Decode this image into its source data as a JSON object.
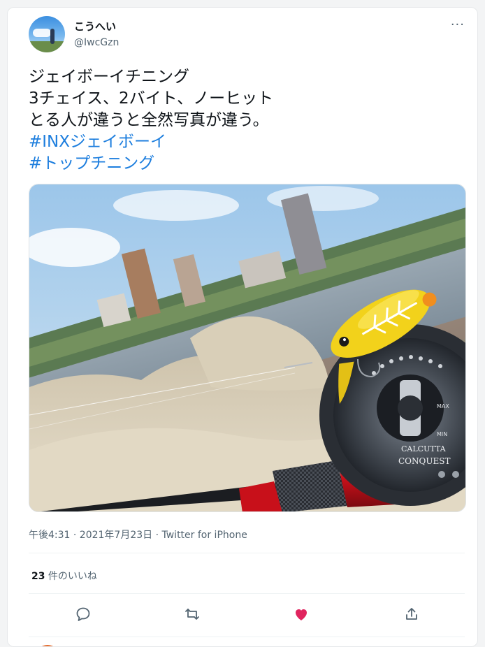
{
  "user": {
    "display_name": "こうへい",
    "handle": "@IwcGzn"
  },
  "tweet": {
    "lines": [
      "ジェイボーイチニング",
      "3チェイス、2バイト、ノーヒット",
      "とる人が違うと全然写真が違う。"
    ],
    "hashtags": [
      "#INXジェイボーイ",
      "#トップチニング"
    ],
    "image": {
      "reel_brand_line1": "CALCUTTA",
      "reel_brand_line2": "CONQUEST",
      "dial_max": "MAX",
      "dial_min": "MIN"
    },
    "meta": "午後4:31 · 2021年7月23日 · Twitter for iPhone",
    "likes_count": "23",
    "likes_label": " 件のいいね"
  },
  "actions": {
    "liked": true,
    "like_color": "#e0245e",
    "icon_color": "#536471",
    "items": [
      "reply-icon",
      "retweet-icon",
      "like-icon",
      "share-icon"
    ]
  },
  "more_label": "···"
}
